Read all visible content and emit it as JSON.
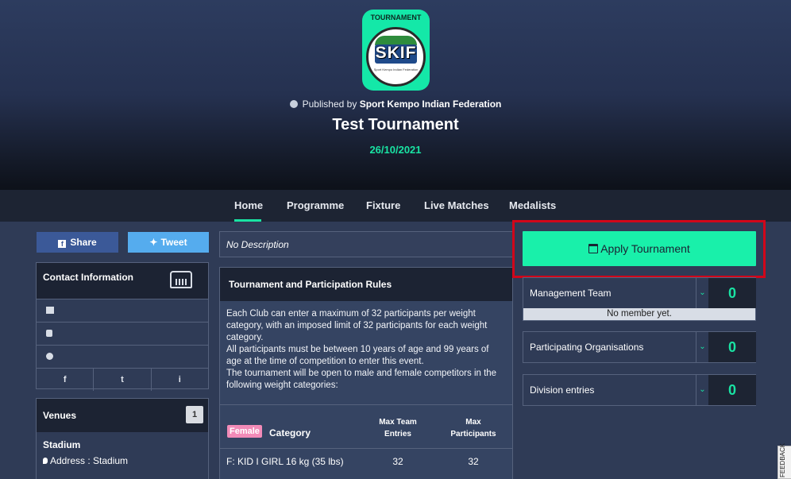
{
  "hero": {
    "logo_label": "TOURNAMENT",
    "logo_text": "SKIF",
    "logo_subtext": "Sport Kempo Indian Federation",
    "published_prefix": "Published by",
    "publisher": "Sport Kempo Indian Federation",
    "title": "Test Tournament",
    "date": "26/10/2021"
  },
  "nav": {
    "items": [
      {
        "label": "Home",
        "active": true
      },
      {
        "label": "Programme",
        "active": false
      },
      {
        "label": "Fixture",
        "active": false
      },
      {
        "label": "Live Matches",
        "active": false
      },
      {
        "label": "Medalists",
        "active": false
      }
    ]
  },
  "share": {
    "share_label": "Share",
    "tweet_label": "Tweet"
  },
  "contact": {
    "title": "Contact Information",
    "icons": [
      "envelope-icon",
      "phone-icon",
      "globe-icon"
    ],
    "social": [
      "f",
      "t",
      "i"
    ]
  },
  "venues": {
    "title": "Venues",
    "count": "1",
    "name": "Stadium",
    "address": "Address : Stadium"
  },
  "description": "No Description",
  "rules": {
    "title": "Tournament and Participation Rules",
    "paragraphs": [
      "Each Club can enter a maximum of 32 participants per weight category, with an imposed limit of 32 participants for each weight category.",
      "All participants must be between 10 years of age and 99 years of age at the time of competition to enter this event.",
      "The tournament will be open to male and female competitors in the following weight categories:"
    ],
    "table": {
      "gender_badge": "Female",
      "category_header": "Category",
      "team_header_1": "Max Team",
      "team_header_2": "Entries",
      "part_header_1": "Max",
      "part_header_2": "Participants",
      "rows": [
        {
          "category": "F: KID I GIRL 16 kg (35 lbs)",
          "team": "32",
          "participants": "32"
        }
      ]
    }
  },
  "apply": {
    "label": "Apply Tournament"
  },
  "side": {
    "management": {
      "label": "Management Team",
      "count": "0",
      "footer": "No member yet."
    },
    "organisations": {
      "label": "Participating Organisations",
      "count": "0"
    },
    "divisions": {
      "label": "Division entries",
      "count": "0"
    }
  },
  "feedback_label": "FEEDBACK",
  "colors": {
    "accent": "#19e3a3",
    "highlight": "#d1061a",
    "facebook": "#3b5998",
    "twitter": "#55acee"
  }
}
